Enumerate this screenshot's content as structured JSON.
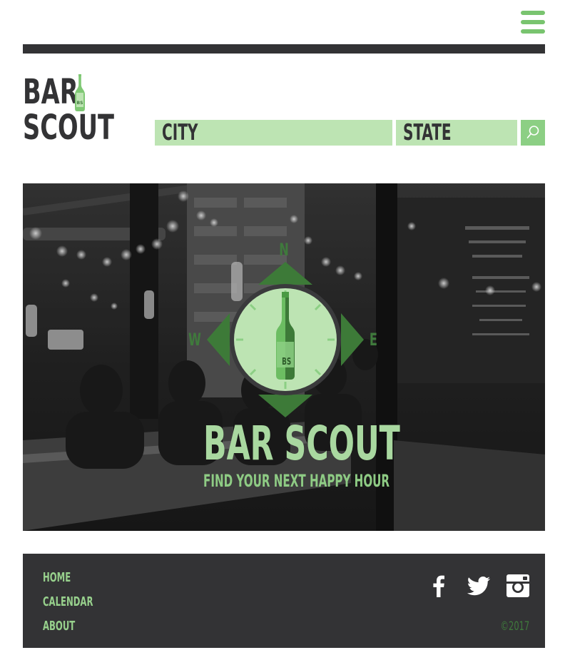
{
  "header": {
    "menu_icon": "hamburger-menu-icon",
    "logo": {
      "line1": "BAR",
      "line2": "SCOUT",
      "bottle_text": "BS"
    }
  },
  "search": {
    "city_label": "CITY",
    "state_label": "STATE",
    "search_icon": "search-icon"
  },
  "hero": {
    "title": "BAR SCOUT",
    "tagline": "FIND YOUR NEXT HAPPY HOUR",
    "compass": {
      "north": "N",
      "south": "",
      "east": "E",
      "west": "W",
      "bottle_text": "BS"
    }
  },
  "footer": {
    "nav": [
      "HOME",
      "CALENDAR",
      "ABOUT"
    ],
    "social": [
      "facebook-icon",
      "twitter-icon",
      "instagram-icon"
    ],
    "copyright": "©2017"
  },
  "colors": {
    "dark": "#333335",
    "accent_green": "#79c46f",
    "light_green": "#bde4b3",
    "mid_green": "#8ccf84",
    "dark_green": "#3f7a3c"
  }
}
